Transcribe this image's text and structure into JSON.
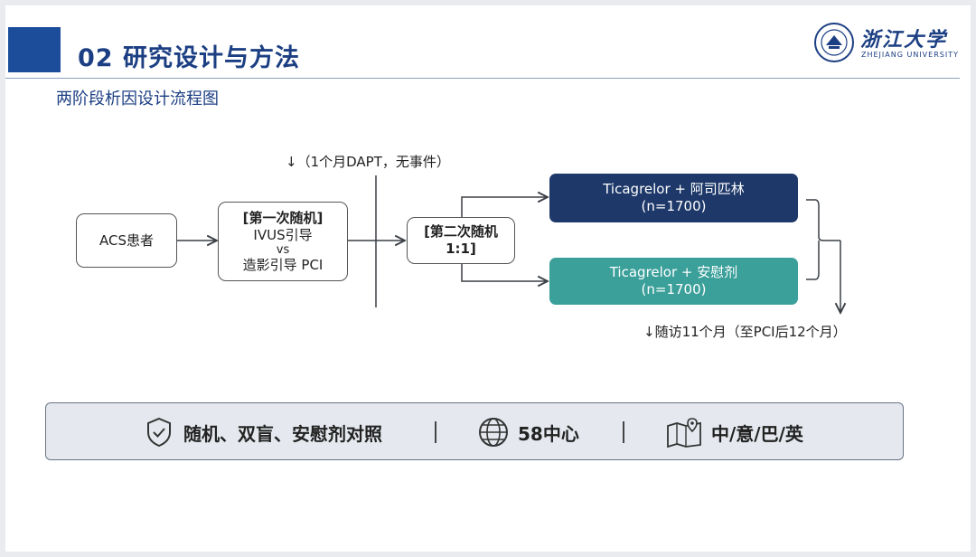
{
  "header": {
    "title": "02  研究设计与方法",
    "subtitle": "两阶段析因设计流程图"
  },
  "logo": {
    "name": "浙江大学",
    "english": "ZHEJIANG UNIVERSITY"
  },
  "flow": {
    "patients": "ACS患者",
    "randomization1": {
      "line1": "[第一次随机]",
      "line2": "IVUS引导",
      "line3": "vs",
      "line4": "造影引导 PCI"
    },
    "dapt_note": "↓（1个月DAPT，无事件）",
    "randomization2": {
      "line1": "[第二次随机",
      "line2": "1:1]"
    },
    "arm1": {
      "drug": "Ticagrelor + 阿司匹林",
      "n": "(n=1700)"
    },
    "arm2": {
      "drug": "Ticagrelor + 安慰剂",
      "n": "(n=1700)"
    },
    "followup": "↓随访11个月（至PCI后12个月）"
  },
  "banner": {
    "items": [
      {
        "icon": "shield-check-icon",
        "text": "随机、双盲、安慰剂对照"
      },
      {
        "icon": "globe-icon",
        "text": "58中心"
      },
      {
        "icon": "map-pin-icon",
        "text": "中/意/巴/英"
      }
    ]
  },
  "colors": {
    "navy": "#1d3869",
    "teal": "#3b9f9a",
    "title_blue": "#1c3f83",
    "accent_block": "#1b4d9b"
  }
}
